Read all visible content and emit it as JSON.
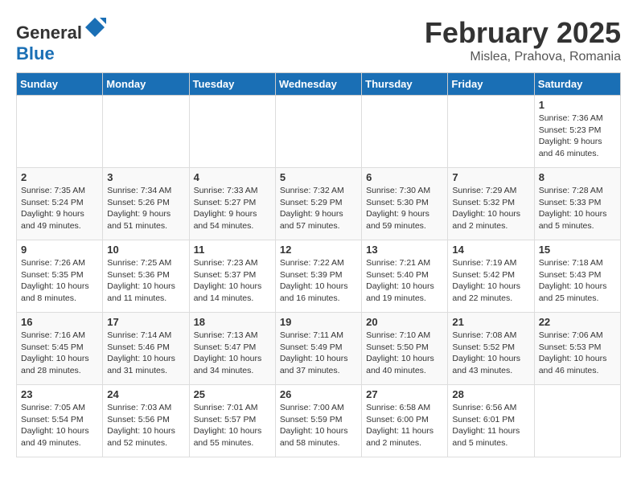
{
  "header": {
    "logo_general": "General",
    "logo_blue": "Blue",
    "month_title": "February 2025",
    "location": "Mislea, Prahova, Romania"
  },
  "days_of_week": [
    "Sunday",
    "Monday",
    "Tuesday",
    "Wednesday",
    "Thursday",
    "Friday",
    "Saturday"
  ],
  "weeks": [
    [
      {
        "day": "",
        "detail": ""
      },
      {
        "day": "",
        "detail": ""
      },
      {
        "day": "",
        "detail": ""
      },
      {
        "day": "",
        "detail": ""
      },
      {
        "day": "",
        "detail": ""
      },
      {
        "day": "",
        "detail": ""
      },
      {
        "day": "1",
        "detail": "Sunrise: 7:36 AM\nSunset: 5:23 PM\nDaylight: 9 hours and 46 minutes."
      }
    ],
    [
      {
        "day": "2",
        "detail": "Sunrise: 7:35 AM\nSunset: 5:24 PM\nDaylight: 9 hours and 49 minutes."
      },
      {
        "day": "3",
        "detail": "Sunrise: 7:34 AM\nSunset: 5:26 PM\nDaylight: 9 hours and 51 minutes."
      },
      {
        "day": "4",
        "detail": "Sunrise: 7:33 AM\nSunset: 5:27 PM\nDaylight: 9 hours and 54 minutes."
      },
      {
        "day": "5",
        "detail": "Sunrise: 7:32 AM\nSunset: 5:29 PM\nDaylight: 9 hours and 57 minutes."
      },
      {
        "day": "6",
        "detail": "Sunrise: 7:30 AM\nSunset: 5:30 PM\nDaylight: 9 hours and 59 minutes."
      },
      {
        "day": "7",
        "detail": "Sunrise: 7:29 AM\nSunset: 5:32 PM\nDaylight: 10 hours and 2 minutes."
      },
      {
        "day": "8",
        "detail": "Sunrise: 7:28 AM\nSunset: 5:33 PM\nDaylight: 10 hours and 5 minutes."
      }
    ],
    [
      {
        "day": "9",
        "detail": "Sunrise: 7:26 AM\nSunset: 5:35 PM\nDaylight: 10 hours and 8 minutes."
      },
      {
        "day": "10",
        "detail": "Sunrise: 7:25 AM\nSunset: 5:36 PM\nDaylight: 10 hours and 11 minutes."
      },
      {
        "day": "11",
        "detail": "Sunrise: 7:23 AM\nSunset: 5:37 PM\nDaylight: 10 hours and 14 minutes."
      },
      {
        "day": "12",
        "detail": "Sunrise: 7:22 AM\nSunset: 5:39 PM\nDaylight: 10 hours and 16 minutes."
      },
      {
        "day": "13",
        "detail": "Sunrise: 7:21 AM\nSunset: 5:40 PM\nDaylight: 10 hours and 19 minutes."
      },
      {
        "day": "14",
        "detail": "Sunrise: 7:19 AM\nSunset: 5:42 PM\nDaylight: 10 hours and 22 minutes."
      },
      {
        "day": "15",
        "detail": "Sunrise: 7:18 AM\nSunset: 5:43 PM\nDaylight: 10 hours and 25 minutes."
      }
    ],
    [
      {
        "day": "16",
        "detail": "Sunrise: 7:16 AM\nSunset: 5:45 PM\nDaylight: 10 hours and 28 minutes."
      },
      {
        "day": "17",
        "detail": "Sunrise: 7:14 AM\nSunset: 5:46 PM\nDaylight: 10 hours and 31 minutes."
      },
      {
        "day": "18",
        "detail": "Sunrise: 7:13 AM\nSunset: 5:47 PM\nDaylight: 10 hours and 34 minutes."
      },
      {
        "day": "19",
        "detail": "Sunrise: 7:11 AM\nSunset: 5:49 PM\nDaylight: 10 hours and 37 minutes."
      },
      {
        "day": "20",
        "detail": "Sunrise: 7:10 AM\nSunset: 5:50 PM\nDaylight: 10 hours and 40 minutes."
      },
      {
        "day": "21",
        "detail": "Sunrise: 7:08 AM\nSunset: 5:52 PM\nDaylight: 10 hours and 43 minutes."
      },
      {
        "day": "22",
        "detail": "Sunrise: 7:06 AM\nSunset: 5:53 PM\nDaylight: 10 hours and 46 minutes."
      }
    ],
    [
      {
        "day": "23",
        "detail": "Sunrise: 7:05 AM\nSunset: 5:54 PM\nDaylight: 10 hours and 49 minutes."
      },
      {
        "day": "24",
        "detail": "Sunrise: 7:03 AM\nSunset: 5:56 PM\nDaylight: 10 hours and 52 minutes."
      },
      {
        "day": "25",
        "detail": "Sunrise: 7:01 AM\nSunset: 5:57 PM\nDaylight: 10 hours and 55 minutes."
      },
      {
        "day": "26",
        "detail": "Sunrise: 7:00 AM\nSunset: 5:59 PM\nDaylight: 10 hours and 58 minutes."
      },
      {
        "day": "27",
        "detail": "Sunrise: 6:58 AM\nSunset: 6:00 PM\nDaylight: 11 hours and 2 minutes."
      },
      {
        "day": "28",
        "detail": "Sunrise: 6:56 AM\nSunset: 6:01 PM\nDaylight: 11 hours and 5 minutes."
      },
      {
        "day": "",
        "detail": ""
      }
    ]
  ]
}
